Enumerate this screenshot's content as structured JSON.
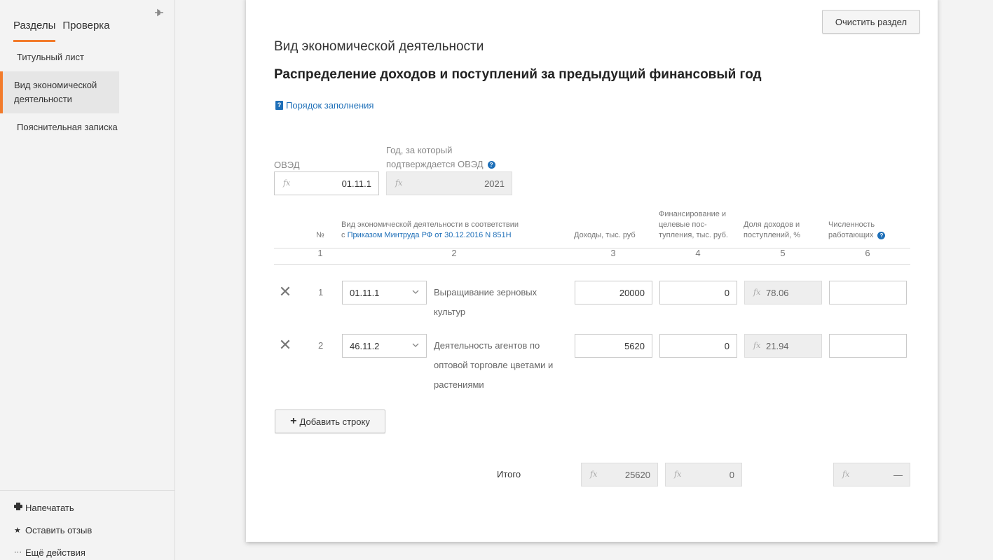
{
  "sidebar": {
    "tabs": [
      "Разделы",
      "Проверка"
    ],
    "items": [
      "Титульный лист",
      "Вид экономической деятельности",
      "Пояснительная записка"
    ],
    "actions": [
      {
        "icon": "printer-icon",
        "label": "Напечатать"
      },
      {
        "icon": "star-icon",
        "label": "Оставить отзыв"
      },
      {
        "icon": "ellipsis-icon",
        "label": "Ещё действия"
      }
    ]
  },
  "main": {
    "clear_button": "Очистить раздел",
    "subtitle": "Вид экономической деятельности",
    "title": "Распределение доходов и поступлений за предыдущий финансовый год",
    "help_link": "Порядок заполнения",
    "oved_label": "ОВЭД",
    "oved_value": "01.11.1",
    "year_label_line1": "Год, за который",
    "year_label_line2": "подтверждается ОВЭД",
    "year_value": "2021",
    "fx": "fx"
  },
  "table": {
    "headers": {
      "num": "№",
      "activity_line1": "Вид экономической деятельности в соответствии",
      "activity_prefix": "с ",
      "activity_link": "Приказом Минтруда РФ от 30.12.2016 N 851Н",
      "income": "Доходы, тыс. руб",
      "financing_line1": "Финансирование и",
      "financing_line2": "целевые пос-",
      "financing_line3": "тупления, тыс. руб.",
      "share_line1": "Доля доходов и",
      "share_line2": "поступлений, %",
      "staff_line1": "Численность",
      "staff_line2": "работающих"
    },
    "column_numbers": [
      "1",
      "2",
      "3",
      "4",
      "5",
      "6"
    ],
    "rows": [
      {
        "num": "1",
        "code": "01.11.1",
        "desc": "Выращивание зерновых культур",
        "income": "20000",
        "financing": "0",
        "share": "78.06",
        "staff": ""
      },
      {
        "num": "2",
        "code": "46.11.2",
        "desc": "Деятельность агентов по оптовой торговле цветами и растениями",
        "income": "5620",
        "financing": "0",
        "share": "21.94",
        "staff": ""
      }
    ],
    "add_row": "Добавить строку",
    "total_label": "Итого",
    "total_income": "25620",
    "total_financing": "0",
    "total_staff": "—"
  }
}
